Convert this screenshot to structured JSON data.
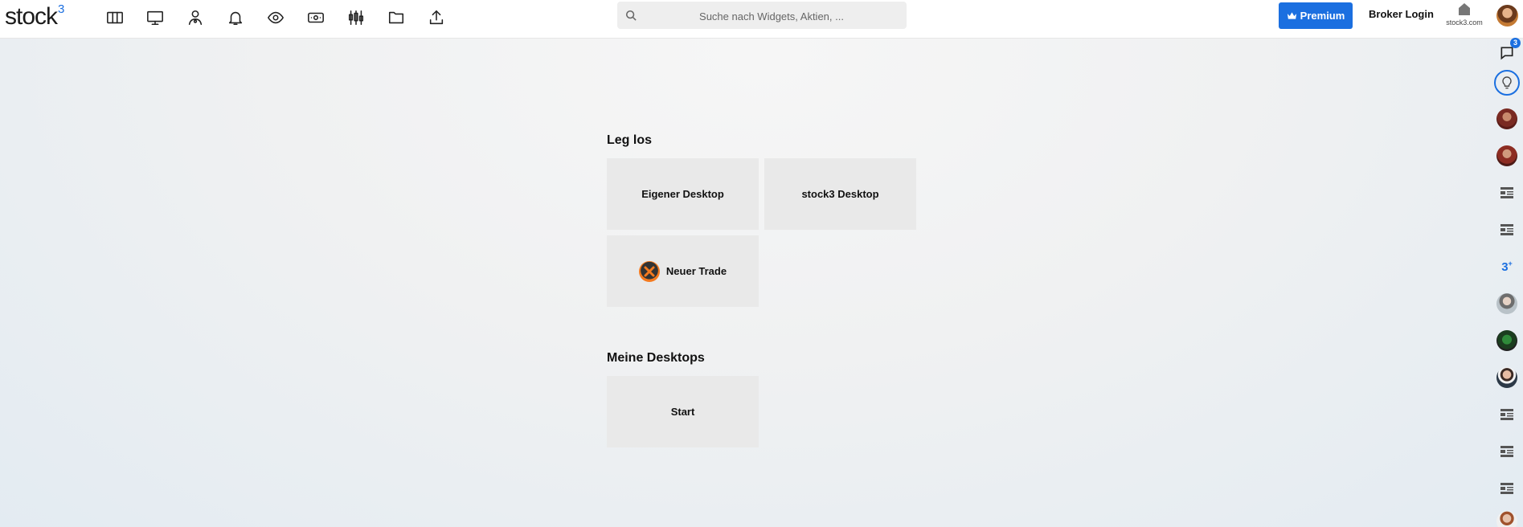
{
  "header": {
    "logo_text": "stock",
    "logo_sup": "3",
    "search_placeholder": "Suche nach Widgets, Aktien, ...",
    "premium_label": "Premium",
    "broker_login_label": "Broker Login",
    "home_label": "stock3.com"
  },
  "toolbar_icons": [
    "columns-icon",
    "monitor-icon",
    "user-icon",
    "bell-icon",
    "eye-icon",
    "banknote-icon",
    "candlestick-icon",
    "folder-icon",
    "upload-icon"
  ],
  "sidebar": {
    "notification_count": "3",
    "three_plus_label": "3",
    "three_plus_sup": "+"
  },
  "main": {
    "getting_started_title": "Leg los",
    "tiles": {
      "own_desktop": "Eigener Desktop",
      "stock3_desktop": "stock3 Desktop",
      "new_trade": "Neuer Trade"
    },
    "my_desktops_title": "Meine Desktops",
    "my_desktops": [
      "Start"
    ]
  },
  "colors": {
    "accent": "#1b6fe0",
    "tile_bg": "#e9e9e9",
    "trade_logo": "#f47a1f"
  }
}
